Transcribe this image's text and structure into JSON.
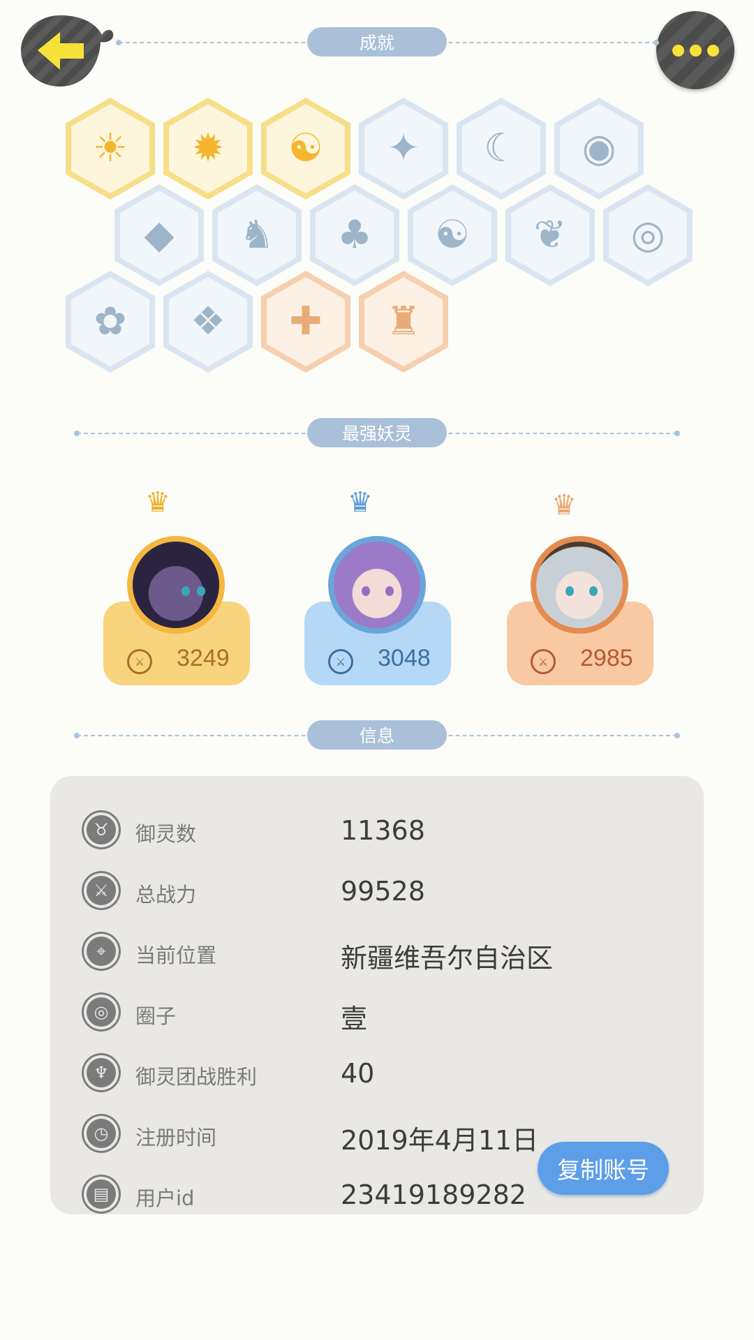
{
  "header": {
    "back_icon": "arrow-left-icon",
    "more_icon": "ellipsis-icon"
  },
  "sections": {
    "achievements": "成就",
    "strongest": "最强妖灵",
    "info": "信息"
  },
  "achievements": [
    {
      "icon": "sun-medal",
      "glyph": "☀",
      "tier": "gold"
    },
    {
      "icon": "fox-bubble",
      "glyph": "✹",
      "tier": "gold"
    },
    {
      "icon": "yin-yang-comet",
      "glyph": "☯",
      "tier": "gold"
    },
    {
      "icon": "sneaker",
      "glyph": "✦",
      "tier": "blue"
    },
    {
      "icon": "moon-orb",
      "glyph": "☾",
      "tier": "blue"
    },
    {
      "icon": "crystal-ball",
      "glyph": "◉",
      "tier": "blue"
    },
    {
      "icon": "gem",
      "glyph": "◆",
      "tier": "blue"
    },
    {
      "icon": "spirit-figure",
      "glyph": "♞",
      "tier": "blue"
    },
    {
      "icon": "cat-wand",
      "glyph": "♣",
      "tier": "blue"
    },
    {
      "icon": "yin-yang-cube",
      "glyph": "☯",
      "tier": "blue"
    },
    {
      "icon": "koi-fish",
      "glyph": "❦",
      "tier": "blue"
    },
    {
      "icon": "shield-target",
      "glyph": "◎",
      "tier": "blue"
    },
    {
      "icon": "bunny",
      "glyph": "✿",
      "tier": "blue"
    },
    {
      "icon": "book-fox",
      "glyph": "❖",
      "tier": "blue"
    },
    {
      "icon": "cat-stroller",
      "glyph": "✚",
      "tier": "peach"
    },
    {
      "icon": "monster-statue",
      "glyph": "♜",
      "tier": "peach"
    }
  ],
  "strongest": [
    {
      "score": "3249",
      "crown_color": "#f0b12a"
    },
    {
      "score": "3048",
      "crown_color": "#5c9ad8"
    },
    {
      "score": "2985",
      "crown_color": "#eea66e"
    }
  ],
  "info": {
    "rows": [
      {
        "icon": "spirit-icon",
        "glyph": "♉",
        "label": "御灵数",
        "value": "11368"
      },
      {
        "icon": "sword-icon",
        "glyph": "⚔",
        "label": "总战力",
        "value": "99528"
      },
      {
        "icon": "location-pin-icon",
        "glyph": "⌖",
        "label": "当前位置",
        "value": "新疆维吾尔自治区"
      },
      {
        "icon": "circle-target-icon",
        "glyph": "◎",
        "label": "圈子",
        "value": "壹"
      },
      {
        "icon": "battle-victory-icon",
        "glyph": "♆",
        "label": "御灵团战胜利",
        "value": "40"
      },
      {
        "icon": "clock-icon",
        "glyph": "◷",
        "label": "注册时间",
        "value": "2019年4月11日"
      },
      {
        "icon": "id-card-icon",
        "glyph": "▤",
        "label": "用户id",
        "value": "23419189282"
      }
    ],
    "copy_button": "复制账号"
  },
  "colors": {
    "background": "#fcfcf8",
    "pill": "#a9c0d8",
    "copy_button": "#5d9ee8",
    "gold": "#f8d47e",
    "blue": "#b5d8f6",
    "peach": "#f8c9a3"
  }
}
